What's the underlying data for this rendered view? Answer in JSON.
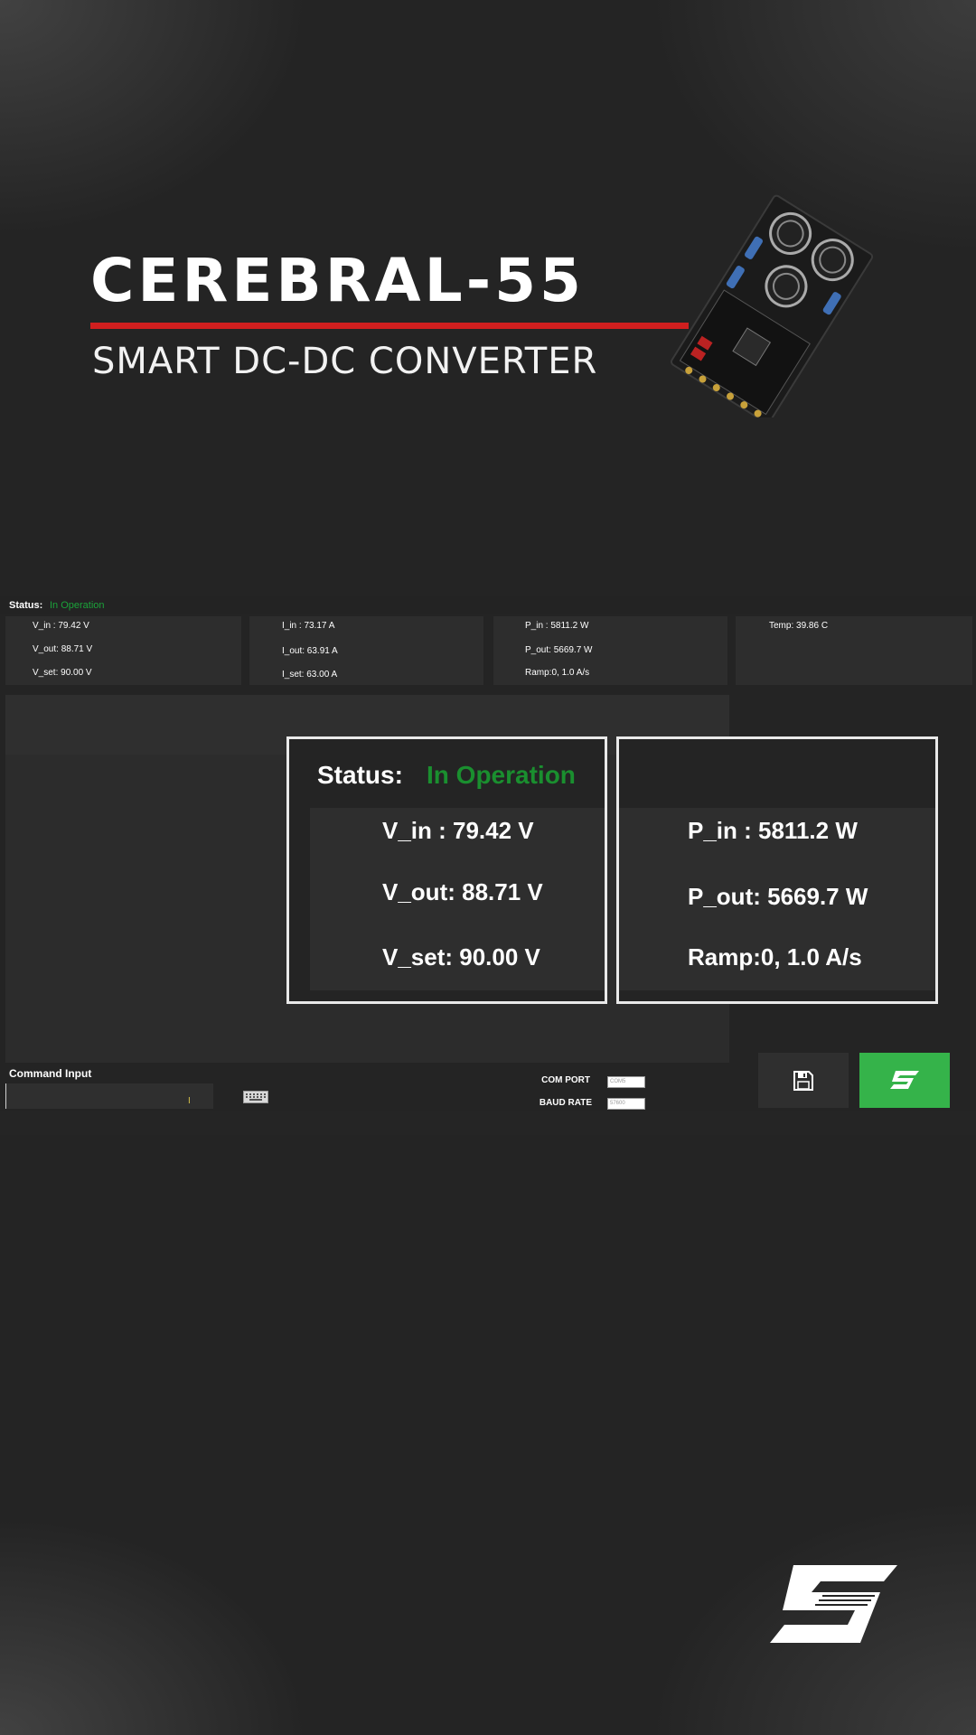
{
  "banner": {
    "title": "CEREBRAL-55",
    "subtitle": "SMART DC-DC CONVERTER",
    "product_image": "converter-board-image",
    "accent_color": "#d01f1f"
  },
  "status": {
    "label": "Status:",
    "value": "In Operation",
    "value_color": "#1ba33a"
  },
  "metrics": {
    "voltage": [
      "V_in : 79.42 V",
      "V_out: 88.71 V",
      "V_set: 90.00 V"
    ],
    "current": [
      "I_in : 73.17 A",
      "I_out: 63.91 A",
      "I_set: 63.00 A"
    ],
    "power": [
      "P_in : 5811.2 W",
      "P_out: 5669.7 W",
      "Ramp:0, 1.0 A/s"
    ],
    "temperature": [
      "Temp: 39.86 C"
    ]
  },
  "overlay": {
    "status_label": "Status:",
    "status_value": "In Operation",
    "left_lines": [
      "V_in : 79.42 V",
      "V_out: 88.71 V",
      "V_set: 90.00 V"
    ],
    "right_lines": [
      "P_in : 5811.2 W",
      "P_out: 5669.7 W",
      "Ramp:0, 1.0 A/s"
    ]
  },
  "command": {
    "label": "Command Input",
    "value": "",
    "keyboard_icon": "keyboard-icon"
  },
  "connection": {
    "com_port_label": "COM PORT",
    "com_port_value": "COM5",
    "baud_rate_label": "BAUD RATE",
    "baud_rate_value": "57600"
  },
  "actions": {
    "save_icon": "save-icon",
    "connect_icon": "brand-s-icon",
    "connect_color": "#35b34a"
  },
  "footer": {
    "logo": "brand-s-logo"
  }
}
